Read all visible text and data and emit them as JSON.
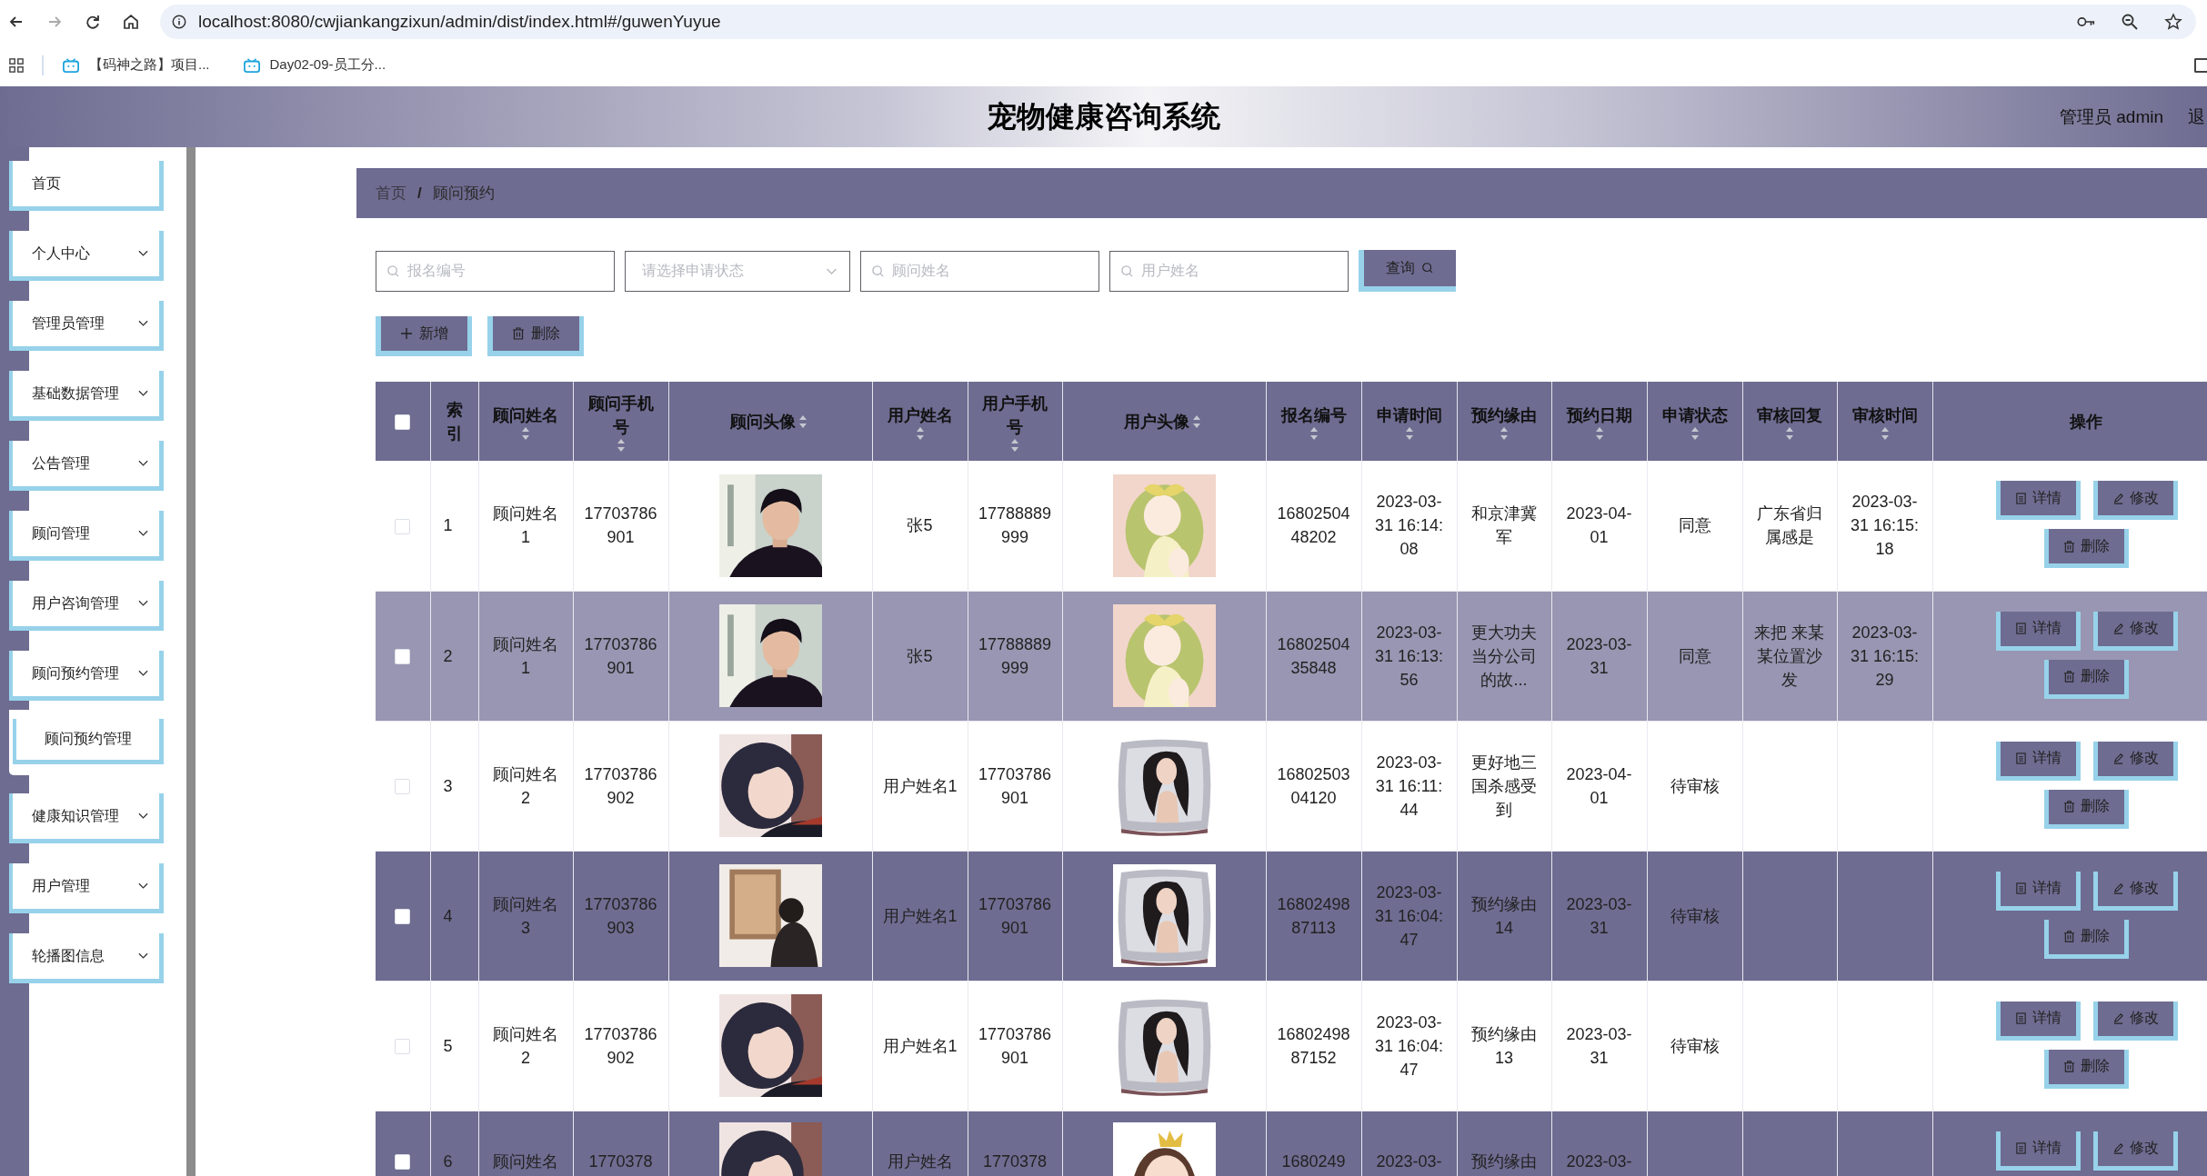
{
  "browser": {
    "url": "localhost:8080/cwjiankangzixun/admin/dist/index.html#/guwenYuyue",
    "bookmarks": [
      "【码神之路】项目...",
      "Day02-09-员工分..."
    ]
  },
  "header": {
    "title": "宠物健康咨询系统",
    "user": "管理员 admin",
    "logout": "退"
  },
  "sidebar": {
    "items": [
      {
        "label": "首页",
        "kind": "link"
      },
      {
        "label": "个人中心",
        "kind": "menu"
      },
      {
        "label": "管理员管理",
        "kind": "menu"
      },
      {
        "label": "基础数据管理",
        "kind": "menu"
      },
      {
        "label": "公告管理",
        "kind": "menu"
      },
      {
        "label": "顾问管理",
        "kind": "menu"
      },
      {
        "label": "用户咨询管理",
        "kind": "menu"
      },
      {
        "label": "顾问预约管理",
        "kind": "menu",
        "expanded": true,
        "children": [
          {
            "label": "顾问预约管理"
          }
        ]
      },
      {
        "label": "健康知识管理",
        "kind": "menu"
      },
      {
        "label": "用户管理",
        "kind": "menu"
      },
      {
        "label": "轮播图信息",
        "kind": "menu"
      }
    ]
  },
  "breadcrumb": {
    "items": [
      "首页",
      "顾问预约"
    ],
    "separator": "/"
  },
  "filters": [
    {
      "kind": "input",
      "placeholder": "报名编号"
    },
    {
      "kind": "select",
      "placeholder": "请选择申请状态"
    },
    {
      "kind": "input",
      "placeholder": "顾问姓名"
    },
    {
      "kind": "input",
      "placeholder": "用户姓名"
    }
  ],
  "search_button": "查询",
  "toolbar": [
    {
      "kind": "add",
      "label": "新增"
    },
    {
      "kind": "delete",
      "label": "删除"
    }
  ],
  "table": {
    "all_checked": false,
    "columns": [
      {
        "label": "索引",
        "sortable": false
      },
      {
        "label": "顾问姓名",
        "sortable": true
      },
      {
        "label": "顾问手机号",
        "sortable": true
      },
      {
        "label": "顾问头像",
        "sortable": true
      },
      {
        "label": "用户姓名",
        "sortable": true
      },
      {
        "label": "用户手机号",
        "sortable": true
      },
      {
        "label": "用户头像",
        "sortable": true
      },
      {
        "label": "报名编号",
        "sortable": true
      },
      {
        "label": "申请时间",
        "sortable": true
      },
      {
        "label": "预约缘由",
        "sortable": true
      },
      {
        "label": "预约日期",
        "sortable": true
      },
      {
        "label": "申请状态",
        "sortable": true
      },
      {
        "label": "审核回复",
        "sortable": true
      },
      {
        "label": "审核时间",
        "sortable": true
      },
      {
        "label": "操作",
        "sortable": false
      }
    ],
    "rows": [
      {
        "checked": false,
        "hovered": false,
        "cells": [
          "1",
          "顾问姓名1",
          "17703786901",
          {
            "kind": "picture"
          },
          "张5",
          "17788889999",
          {
            "kind": "picture"
          },
          "1680250448202",
          "2023-03-31 16:14:08",
          "和京津冀军",
          "2023-04-01",
          "同意",
          "广东省归属感是",
          "2023-03-31 16:15:18"
        ],
        "actions": [
          {
            "kind": "detail",
            "label": "详情"
          },
          {
            "kind": "edit",
            "label": "修改"
          },
          {
            "kind": "delete",
            "label": "删除"
          }
        ]
      },
      {
        "checked": false,
        "hovered": true,
        "cells": [
          "2",
          "顾问姓名1",
          "17703786901",
          {
            "kind": "picture"
          },
          "张5",
          "17788889999",
          {
            "kind": "picture"
          },
          "1680250435848",
          "2023-03-31 16:13:56",
          "更大功夫当分公司的故...",
          "2023-03-31",
          "同意",
          "来把 来某某位置沙发",
          "2023-03-31 16:15:29"
        ],
        "actions": [
          {
            "kind": "detail",
            "label": "详情"
          },
          {
            "kind": "edit",
            "label": "修改"
          },
          {
            "kind": "delete",
            "label": "删除"
          }
        ]
      },
      {
        "checked": false,
        "hovered": false,
        "cells": [
          "3",
          "顾问姓名2",
          "17703786902",
          {
            "kind": "picture"
          },
          "用户姓名1",
          "17703786901",
          {
            "kind": "picture"
          },
          "1680250304120",
          "2023-03-31 16:11:44",
          "更好地三国杀感受到",
          "2023-04-01",
          "待审核",
          null,
          null
        ],
        "actions": [
          {
            "kind": "detail",
            "label": "详情"
          },
          {
            "kind": "edit",
            "label": "修改"
          },
          {
            "kind": "delete",
            "label": "删除"
          }
        ]
      },
      {
        "checked": false,
        "hovered": false,
        "cells": [
          "4",
          "顾问姓名3",
          "17703786903",
          {
            "kind": "picture"
          },
          "用户姓名1",
          "17703786901",
          {
            "kind": "picture"
          },
          "1680249887113",
          "2023-03-31 16:04:47",
          "预约缘由14",
          "2023-03-31",
          "待审核",
          null,
          null
        ],
        "actions": [
          {
            "kind": "detail",
            "label": "详情"
          },
          {
            "kind": "edit",
            "label": "修改"
          },
          {
            "kind": "delete",
            "label": "删除"
          }
        ]
      },
      {
        "checked": false,
        "hovered": false,
        "cells": [
          "5",
          "顾问姓名2",
          "17703786902",
          {
            "kind": "picture"
          },
          "用户姓名1",
          "17703786901",
          {
            "kind": "picture"
          },
          "1680249887152",
          "2023-03-31 16:04:47",
          "预约缘由13",
          "2023-03-31",
          "待审核",
          null,
          null
        ],
        "actions": [
          {
            "kind": "detail",
            "label": "详情"
          },
          {
            "kind": "edit",
            "label": "修改"
          },
          {
            "kind": "delete",
            "label": "删除"
          }
        ]
      },
      {
        "checked": false,
        "hovered": false,
        "cells": [
          "6",
          "顾问姓名",
          "1770378",
          {
            "kind": "picture"
          },
          "用户姓名",
          "1770378",
          {
            "kind": "picture"
          },
          "1680249",
          "2023-03-",
          "预约缘由",
          "2023-03-",
          null,
          null,
          null
        ],
        "actions": [
          {
            "kind": "detail",
            "label": "详情"
          },
          {
            "kind": "edit",
            "label": "修改"
          }
        ]
      }
    ]
  }
}
